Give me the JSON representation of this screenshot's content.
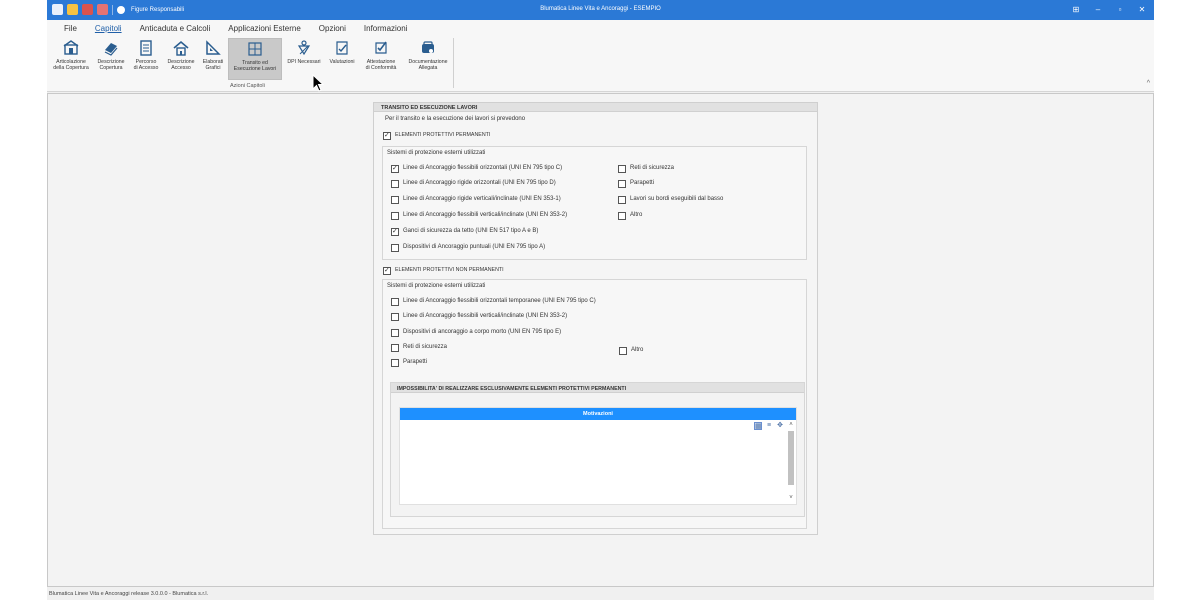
{
  "window": {
    "title": "Blumatica Linee Vita e Ancoraggi - ESEMPIO",
    "responsabili": "Figure Responsabili",
    "minimize": "–",
    "maximize": "▫",
    "close": "✕",
    "layout": "⊞"
  },
  "menu": {
    "items": [
      "File",
      "Capitoli",
      "Anticaduta e Calcoli",
      "Applicazioni Esterne",
      "Opzioni",
      "Informazioni"
    ],
    "active": "Capitoli"
  },
  "ribbon": {
    "buttons": [
      {
        "label": "Articolazione\ndella Copertura",
        "icon": "roof-structure-icon"
      },
      {
        "label": "Descrizione\nCopertura",
        "icon": "roof-description-icon"
      },
      {
        "label": "Percorso\ndi Accesso",
        "icon": "access-path-icon"
      },
      {
        "label": "Descrizione\nAccesso",
        "icon": "house-icon"
      },
      {
        "label": "Elaborati\nGrafici",
        "icon": "set-square-icon"
      },
      {
        "label": "Transito ed\nEsecuzione Lavori",
        "icon": "transit-icon"
      },
      {
        "label": "DPI Necessari",
        "icon": "harness-icon"
      },
      {
        "label": "Valutazioni",
        "icon": "evaluation-icon"
      },
      {
        "label": "Attestazione\ndi Conformità",
        "icon": "certificate-icon"
      },
      {
        "label": "Documentazione\nAllegata",
        "icon": "attachment-icon"
      }
    ],
    "group_label": "Azioni Capitoli",
    "collapse": "^"
  },
  "panel": {
    "title": "TRANSITO ED ESECUZIONE LAVORI",
    "intro": "Per il transito e la esecuzione dei lavori si prevedono",
    "permanent": {
      "label": "ELEMENTI PROTETTIVI PERMANENTI",
      "checked": true,
      "group_title": "Sistemi di protezione esterni utilizzati",
      "left": [
        {
          "label": "Linee di Ancoraggio flessibili orizzontali (UNI EN 795 tipo C)",
          "checked": true
        },
        {
          "label": "Linee di Ancoraggio rigide orizzontali (UNI EN 795 tipo D)",
          "checked": false
        },
        {
          "label": "Linee di Ancoraggio rigide verticali/inclinate (UNI EN 353-1)",
          "checked": false
        },
        {
          "label": "Linee di Ancoraggio flessibili verticali/inclinate (UNI EN 353-2)",
          "checked": false
        },
        {
          "label": "Ganci di sicurezza da tetto (UNI EN 517 tipo A e B)",
          "checked": true
        },
        {
          "label": "Dispositivi di Ancoraggio puntuali (UNI EN 795 tipo A)",
          "checked": false
        }
      ],
      "right": [
        {
          "label": "Reti di sicurezza",
          "checked": false
        },
        {
          "label": "Parapetti",
          "checked": false
        },
        {
          "label": "Lavori su bordi eseguibili dal basso",
          "checked": false
        },
        {
          "label": "Altro",
          "checked": false
        }
      ]
    },
    "non_permanent": {
      "label": "ELEMENTI PROTETTIVI NON PERMANENTI",
      "checked": true,
      "group_title": "Sistemi di protezione esterni utilizzati",
      "left": [
        {
          "label": "Linee di Ancoraggio flessibili orizzontali temporanee (UNI EN 795 tipo C)",
          "checked": false
        },
        {
          "label": "Linee di Ancoraggio flessibili verticali/inclinate (UNI EN 353-2)",
          "checked": false
        },
        {
          "label": "Dispositivi di ancoraggio a corpo morto (UNI EN 795 tipo E)",
          "checked": false
        },
        {
          "label": "Reti di sicurezza",
          "checked": false
        },
        {
          "label": "Parapetti",
          "checked": false
        }
      ],
      "altro": {
        "label": "Altro",
        "checked": false
      }
    },
    "impossibility": {
      "title": "IMPOSSIBILITA' DI REALIZZARE ESCLUSIVAMENTE ELEMENTI PROTETTIVI PERMANENTI",
      "grid_header": "Motivazioni"
    }
  },
  "status": "Blumatica Linee Vita e Ancoraggi release 3.0.0.0 - Blumatica s.r.l.",
  "colors": {
    "titlebar": "#2b79d6",
    "grid_header": "#1e90ff"
  }
}
